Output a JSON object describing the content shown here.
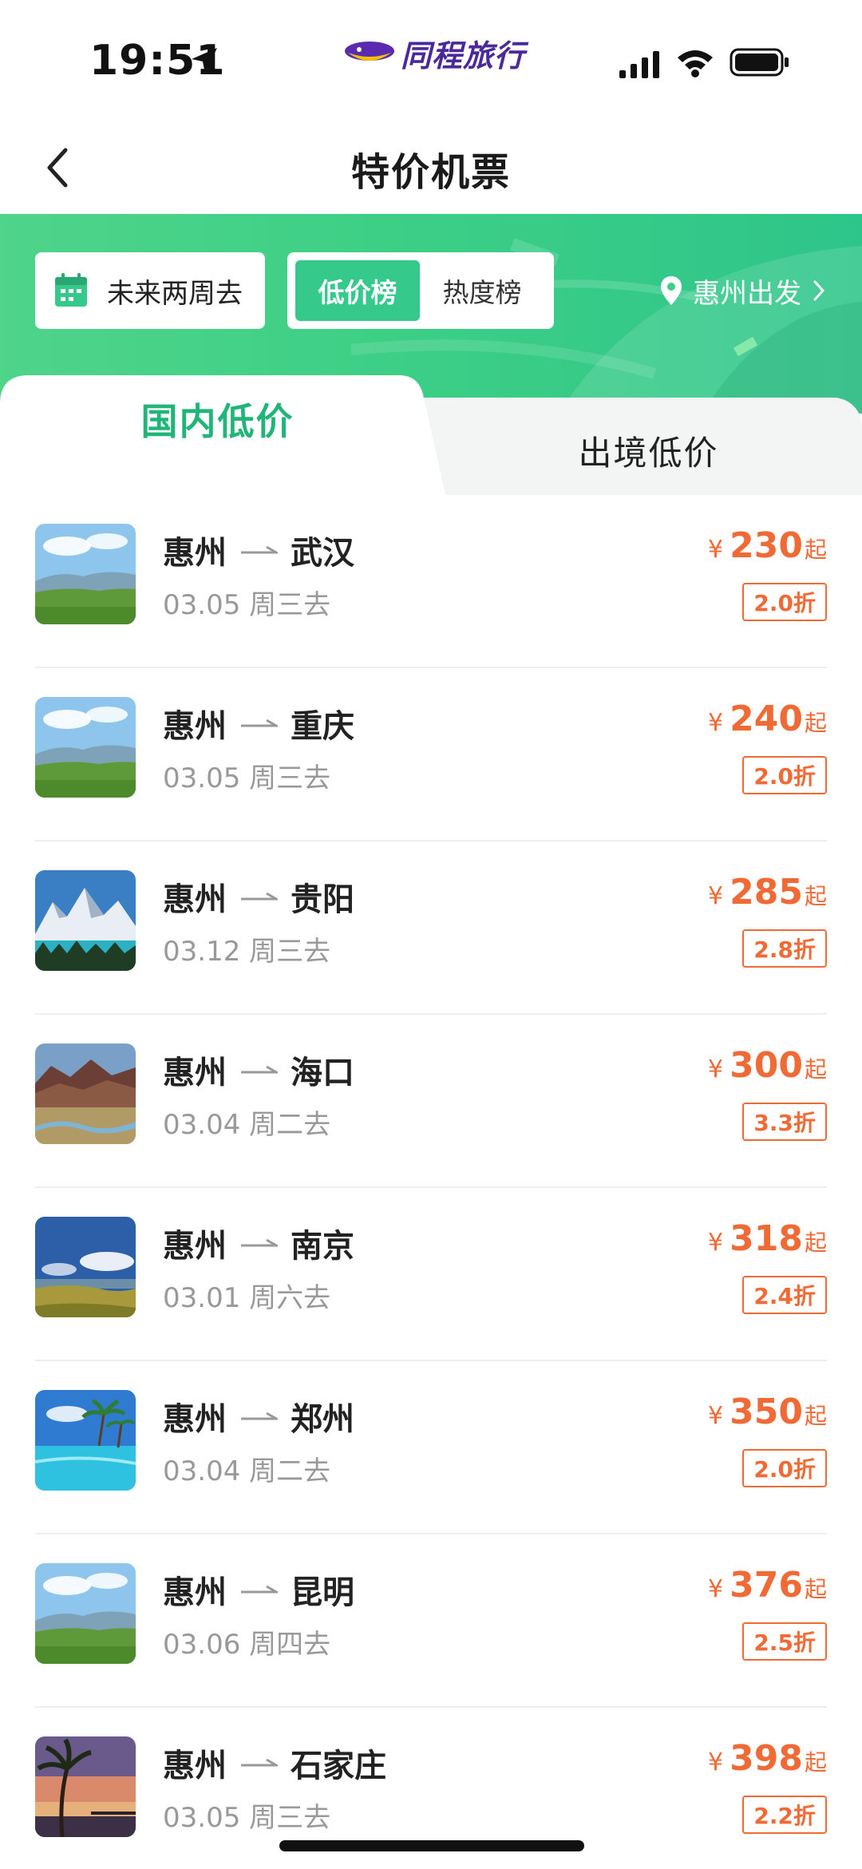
{
  "status_bar": {
    "time": "19:51",
    "brand": "同程旅行"
  },
  "nav": {
    "title": "特价机票"
  },
  "filters": {
    "date_range": "未来两周去",
    "rank_tabs": [
      {
        "label": "低价榜",
        "active": true
      },
      {
        "label": "热度榜",
        "active": false
      }
    ],
    "departure": "惠州出发"
  },
  "category_tabs": [
    {
      "label": "国内低价",
      "active": true
    },
    {
      "label": "出境低价",
      "active": false
    }
  ],
  "colors": {
    "brand_green": "#35c98b",
    "active_tab_text": "#22b57a",
    "price_orange": "#f06a35"
  },
  "flights": [
    {
      "from": "惠州",
      "to": "武汉",
      "date": "03.05 周三去",
      "currency": "¥",
      "price": "230",
      "price_suffix": "起",
      "discount": "2.0折",
      "thumb": "grassland-image"
    },
    {
      "from": "惠州",
      "to": "重庆",
      "date": "03.05 周三去",
      "currency": "¥",
      "price": "240",
      "price_suffix": "起",
      "discount": "2.0折",
      "thumb": "grassland-image"
    },
    {
      "from": "惠州",
      "to": "贵阳",
      "date": "03.12 周三去",
      "currency": "¥",
      "price": "285",
      "price_suffix": "起",
      "discount": "2.8折",
      "thumb": "snow-mountain-image"
    },
    {
      "from": "惠州",
      "to": "海口",
      "date": "03.04 周二去",
      "currency": "¥",
      "price": "300",
      "price_suffix": "起",
      "discount": "3.3折",
      "thumb": "canyon-river-image"
    },
    {
      "from": "惠州",
      "to": "南京",
      "date": "03.01 周六去",
      "currency": "¥",
      "price": "318",
      "price_suffix": "起",
      "discount": "2.4折",
      "thumb": "lake-hills-image"
    },
    {
      "from": "惠州",
      "to": "郑州",
      "date": "03.04 周二去",
      "currency": "¥",
      "price": "350",
      "price_suffix": "起",
      "discount": "2.0折",
      "thumb": "tropical-pool-image"
    },
    {
      "from": "惠州",
      "to": "昆明",
      "date": "03.06 周四去",
      "currency": "¥",
      "price": "376",
      "price_suffix": "起",
      "discount": "2.5折",
      "thumb": "grassland-image"
    },
    {
      "from": "惠州",
      "to": "石家庄",
      "date": "03.05 周三去",
      "currency": "¥",
      "price": "398",
      "price_suffix": "起",
      "discount": "2.2折",
      "thumb": "beach-sunset-image"
    }
  ]
}
